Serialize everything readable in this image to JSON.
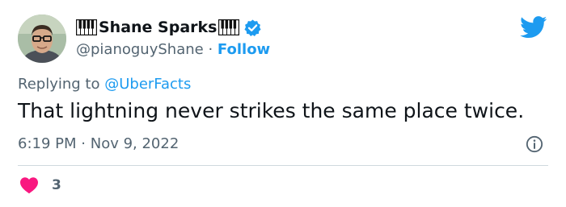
{
  "author": {
    "display_name": "Shane Sparks",
    "handle": "@pianoguyShane",
    "separator": "·",
    "follow_label": "Follow"
  },
  "reply": {
    "prefix": "Replying to",
    "mention": "@UberFacts"
  },
  "tweet": {
    "text": "That lightning never strikes the same place twice."
  },
  "meta": {
    "time": "6:19 PM",
    "separator": "·",
    "date": "Nov 9, 2022"
  },
  "engagement": {
    "likes": "3"
  },
  "colors": {
    "accent": "#1d9bf0",
    "heart": "#f91880",
    "muted": "#536471",
    "text": "#0f1419"
  },
  "icons": [
    "avatar",
    "piano-keys-icon",
    "verified-badge-icon",
    "twitter-bird-icon",
    "info-icon",
    "heart-icon"
  ]
}
